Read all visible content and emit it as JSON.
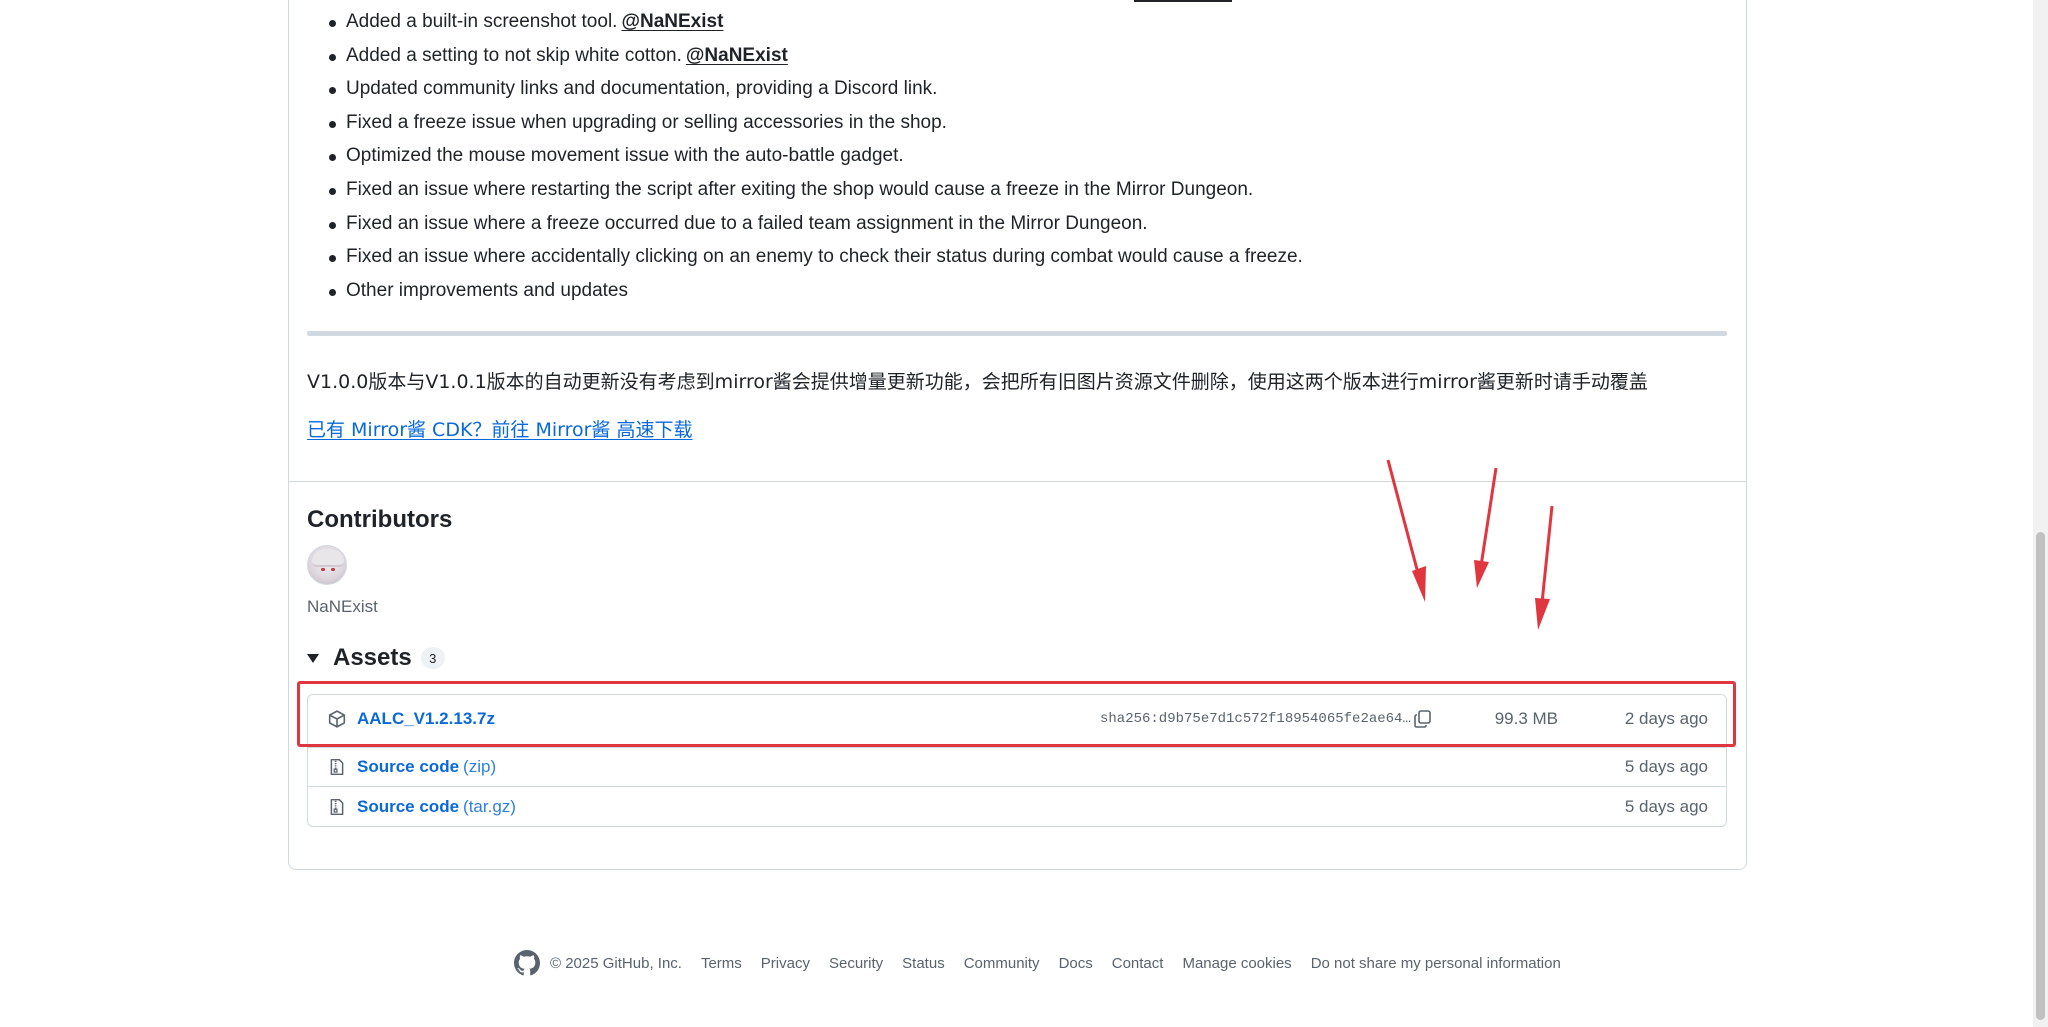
{
  "release_notes": [
    {
      "text": "Added a built-in screenshot tool.",
      "mention": "@NaNExist"
    },
    {
      "text": "Added a setting to not skip white cotton.",
      "mention": "@NaNExist"
    },
    {
      "text": "Updated community links and documentation, providing a Discord link."
    },
    {
      "text": "Fixed a freeze issue when upgrading or selling accessories in the shop."
    },
    {
      "text": "Optimized the mouse movement issue with the auto-battle gadget."
    },
    {
      "text": "Fixed an issue where restarting the script after exiting the shop would cause a freeze in the Mirror Dungeon."
    },
    {
      "text": "Fixed an issue where a freeze occurred due to a failed team assignment in the Mirror Dungeon."
    },
    {
      "text": "Fixed an issue where accidentally clicking on an enemy to check their status during combat would cause a freeze."
    },
    {
      "text": "Other improvements and updates"
    }
  ],
  "cn_note": "V1.0.0版本与V1.0.1版本的自动更新没有考虑到mirror酱会提供增量更新功能，会把所有旧图片资源文件删除，使用这两个版本进行mirror酱更新时请手动覆盖",
  "cn_link": "已有 Mirror酱 CDK？前往 Mirror酱 高速下载",
  "contributors": {
    "title": "Contributors",
    "people": [
      {
        "name": "NaNExist"
      }
    ]
  },
  "assets": {
    "title": "Assets",
    "count": "3",
    "items": [
      {
        "name": "AALC_V1.2.13.7z",
        "sha": "sha256:d9b75e7d1c572f18954065fe2ae64…",
        "size": "99.3 MB",
        "date": "2 days ago",
        "icon": "package-icon"
      },
      {
        "name": "Source code",
        "suffix": "(zip)",
        "date": "5 days ago",
        "icon": "file-zip-icon"
      },
      {
        "name": "Source code",
        "suffix": "(tar.gz)",
        "date": "5 days ago",
        "icon": "file-zip-icon"
      }
    ]
  },
  "footer": {
    "copyright": "© 2025 GitHub, Inc.",
    "links": [
      "Terms",
      "Privacy",
      "Security",
      "Status",
      "Community",
      "Docs",
      "Contact",
      "Manage cookies",
      "Do not share my personal information"
    ]
  },
  "colors": {
    "link": "#0969da",
    "highlight": "#e0363f",
    "text": "#1f2328",
    "muted": "#59636e"
  }
}
